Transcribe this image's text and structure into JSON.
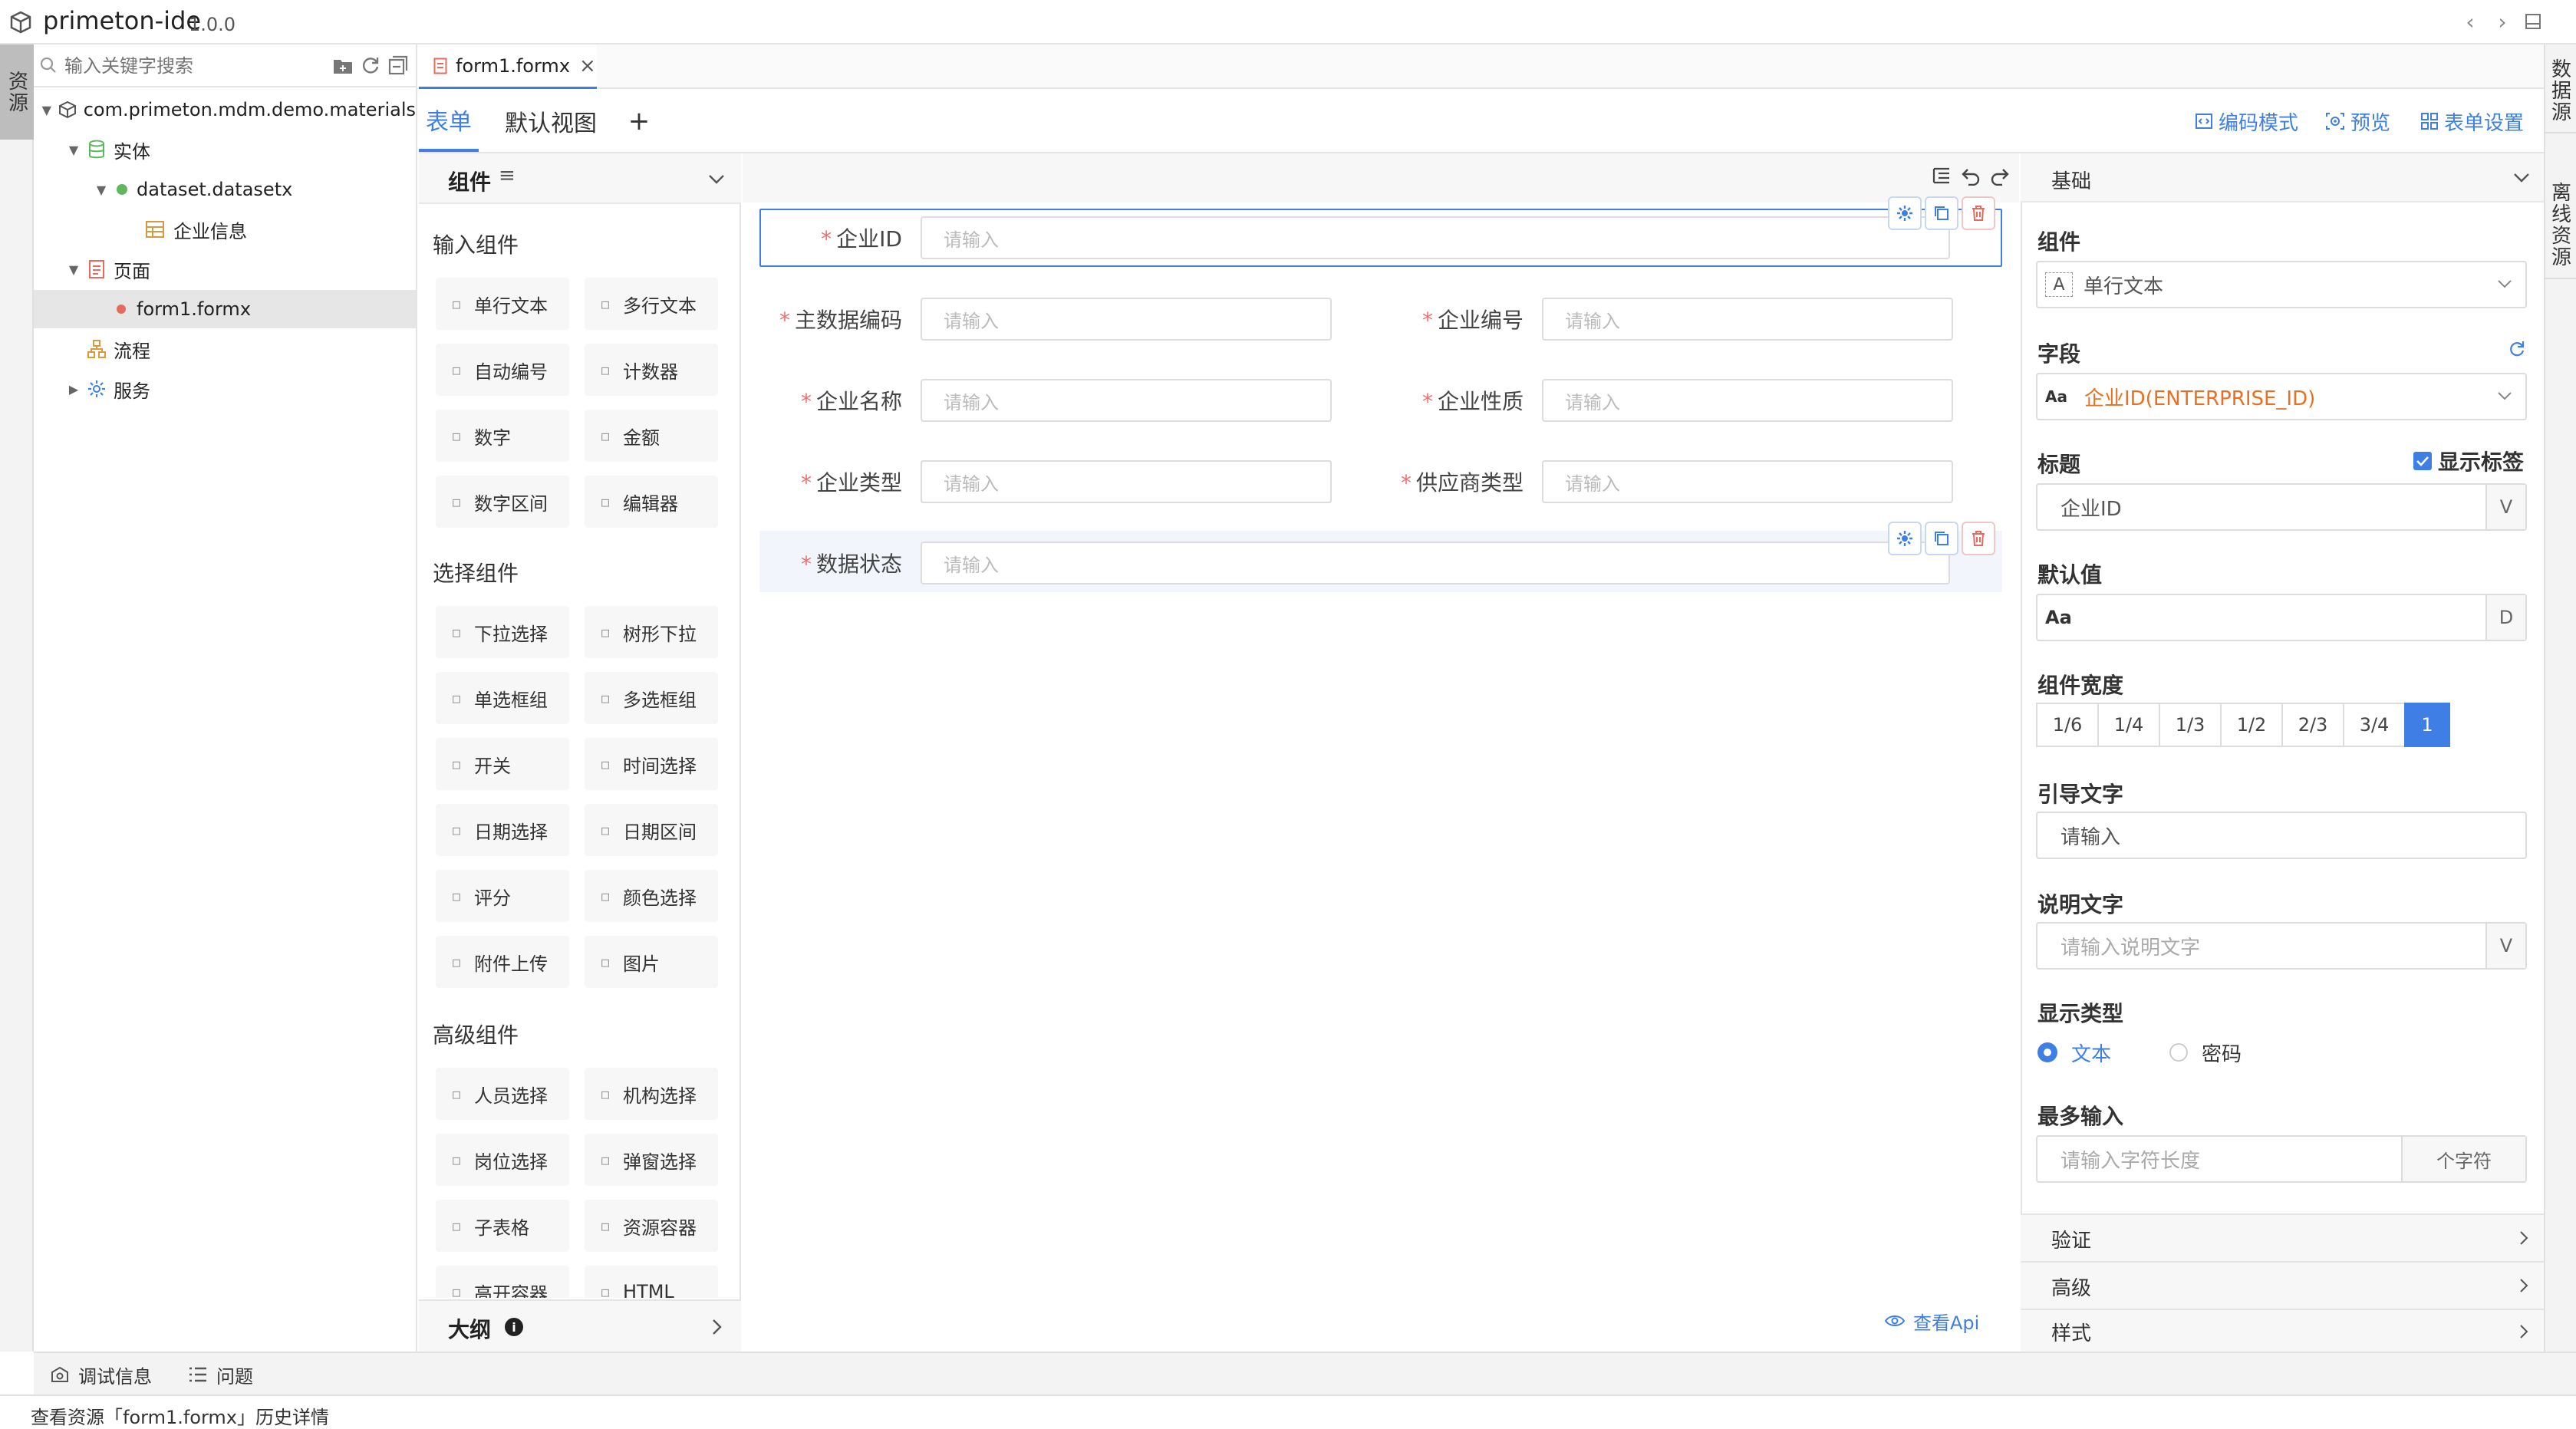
{
  "window": {
    "title": "primeton-ide",
    "version": "1.0.0"
  },
  "left_strip": {
    "resources_tab": "资源"
  },
  "right_strip": {
    "datasource_tab": "数据源",
    "offline_tab": "离线资源"
  },
  "explorer": {
    "search_placeholder": "输入关键字搜索",
    "tree": {
      "root": "com.primeton.mdm.demo.materials",
      "entity": "实体",
      "dataset": "dataset.datasetx",
      "enterprise": "企业信息",
      "page": "页面",
      "form": "form1.formx",
      "flow": "流程",
      "service": "服务"
    }
  },
  "editor": {
    "file_tab": "form1.formx"
  },
  "form_tabs": {
    "form": "表单",
    "default_view": "默认视图",
    "add": "+",
    "code_mode": "编码模式",
    "preview": "预览",
    "form_settings": "表单设置"
  },
  "palette": {
    "header": "组件",
    "groups": {
      "input": "输入组件",
      "select": "选择组件",
      "advanced": "高级组件"
    },
    "input_items": [
      "单行文本",
      "多行文本",
      "自动编号",
      "计数器",
      "数字",
      "金额",
      "数字区间",
      "编辑器"
    ],
    "select_items": [
      "下拉选择",
      "树形下拉",
      "单选框组",
      "多选框组",
      "开关",
      "时间选择",
      "日期选择",
      "日期区间",
      "评分",
      "颜色选择",
      "附件上传",
      "图片"
    ],
    "advanced_items": [
      "人员选择",
      "机构选择",
      "岗位选择",
      "弹窗选择",
      "子表格",
      "资源容器",
      "高开容器",
      "HTML"
    ],
    "outline": "大纲"
  },
  "canvas": {
    "fields": [
      {
        "label": "企业ID",
        "placeholder": "请输入"
      },
      {
        "label": "主数据编码",
        "placeholder": "请输入"
      },
      {
        "label": "企业编号",
        "placeholder": "请输入"
      },
      {
        "label": "企业名称",
        "placeholder": "请输入"
      },
      {
        "label": "企业性质",
        "placeholder": "请输入"
      },
      {
        "label": "企业类型",
        "placeholder": "请输入"
      },
      {
        "label": "供应商类型",
        "placeholder": "请输入"
      },
      {
        "label": "数据状态",
        "placeholder": "请输入"
      }
    ],
    "required_mark": "*",
    "view_api": "查看Api"
  },
  "props": {
    "section": "基础",
    "component_label": "组件",
    "component_value": "单行文本",
    "field_label": "字段",
    "field_value": "企业ID(ENTERPRISE_ID)",
    "field_type_badge": "Aa",
    "title_label": "标题",
    "show_label": "显示标签",
    "title_value": "企业ID",
    "title_suffix": "V",
    "default_label": "默认值",
    "default_value": "Aa",
    "default_suffix": "D",
    "width_label": "组件宽度",
    "widths": [
      "1/6",
      "1/4",
      "1/3",
      "1/2",
      "2/3",
      "3/4",
      "1"
    ],
    "width_selected": "1",
    "hint_label": "引导文字",
    "hint_value": "请输入",
    "desc_label": "说明文字",
    "desc_placeholder": "请输入说明文字",
    "desc_suffix": "V",
    "display_label": "显示类型",
    "display_options": [
      "文本",
      "密码"
    ],
    "display_selected": "文本",
    "max_label": "最多输入",
    "max_placeholder": "请输入字符长度",
    "max_suffix": "个字符",
    "collapsed": [
      "验证",
      "高级",
      "样式"
    ]
  },
  "bottom": {
    "debug": "调试信息",
    "problems": "问题",
    "status": "查看资源「form1.formx」历史详情"
  },
  "colors": {
    "accent": "#3f7fe5",
    "required": "#f56c6c",
    "field_highlight": "#ea6f1e"
  }
}
